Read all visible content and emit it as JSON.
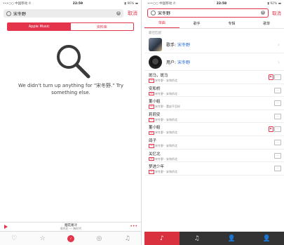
{
  "left": {
    "status": {
      "carrier": "•••○○ 中国移动 ✆",
      "time": "22:59",
      "battery": "▮ 96% ▬"
    },
    "search": {
      "query": "宋冬野",
      "cancel": "取消"
    },
    "segments": [
      "Apple Music",
      "资料库"
    ],
    "no_results": "We didn't turn up anything for \"宋冬野.\" Try something else.",
    "now_playing": {
      "title": "烟花易冷",
      "subtitle": "周杰伦 — 跨时代"
    },
    "tabbar": [
      "♡",
      "☆",
      "♪",
      "◎",
      "♫"
    ]
  },
  "right": {
    "status": {
      "carrier": "•••○○ 中国移动 ✆",
      "time": "22:58",
      "battery": "▮ 92% ▬"
    },
    "search": {
      "query": "宋冬野",
      "cancel": "取消"
    },
    "tabs": [
      "单曲",
      "歌手",
      "专辑",
      "歌单"
    ],
    "section_title": "最佳匹配",
    "artists": [
      {
        "prefix": "歌手: ",
        "name": "宋冬野"
      },
      {
        "prefix": "用户: ",
        "name": "宋冬野"
      }
    ],
    "songs": [
      {
        "name": "斑马，斑马",
        "sub": "宋冬野 - 安和桥北",
        "mv": true
      },
      {
        "name": "安和桥",
        "sub": "宋冬野 - 安和桥北",
        "mv": false
      },
      {
        "name": "董小姐",
        "sub": "宋冬野 - 董皮不怎样",
        "mv": false
      },
      {
        "name": "莉莉安",
        "sub": "宋冬野 - 安和桥北",
        "mv": false
      },
      {
        "name": "董小姐",
        "sub": "宋冬野 - 安和桥北",
        "mv": true
      },
      {
        "name": "鸽子",
        "sub": "宋冬野 - 安和桥北",
        "mv": false
      },
      {
        "name": "关忆北",
        "sub": "宋冬野 - 安和桥北",
        "mv": false
      },
      {
        "name": "梦进少年",
        "sub": "宋冬野 - 安和桥北",
        "mv": false
      }
    ],
    "tabbar": [
      "♪",
      "♫",
      "👤",
      "👤"
    ]
  }
}
